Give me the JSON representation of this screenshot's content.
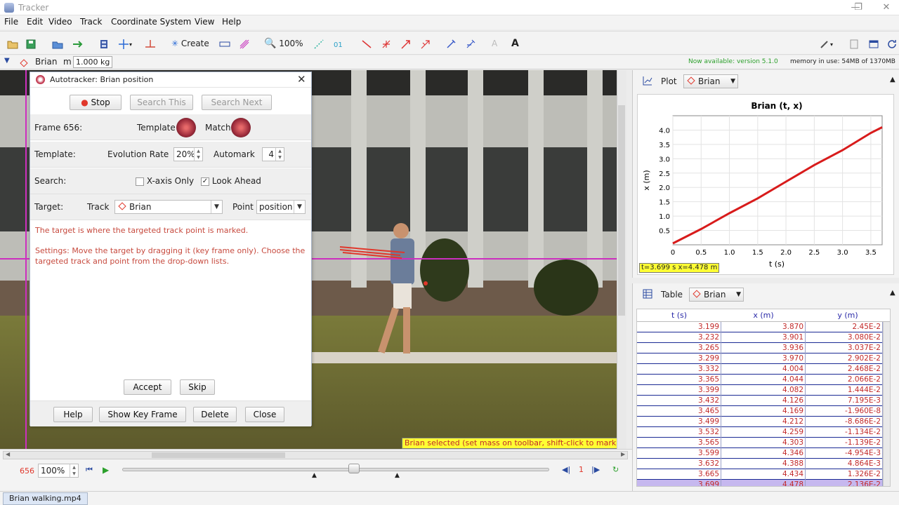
{
  "window": {
    "title": "Tracker"
  },
  "menu": [
    "File",
    "Edit",
    "Video",
    "Track",
    "Coordinate System",
    "View",
    "Help"
  ],
  "toolbar": {
    "create_label": "Create",
    "zoom_label": "100%",
    "font_label": "A"
  },
  "trackbar": {
    "track_name": "Brian",
    "mass_prefix": "m",
    "mass_value": "1.000 kg",
    "version_notice": "Now available: version 5.1.0",
    "memory_label": "memory in use: 54MB of 1370MB"
  },
  "dialog": {
    "title": "Autotracker: Brian position",
    "stop_label": "Stop",
    "search_this_label": "Search This",
    "search_next_label": "Search Next",
    "frame_label": "Frame 656:",
    "template_label": "Template",
    "match_label": "Match",
    "template_row_label": "Template:",
    "evolution_label": "Evolution Rate",
    "evolution_value": "20%",
    "automark_label": "Automark",
    "automark_value": "4",
    "search_row_label": "Search:",
    "xaxis_label": "X-axis Only",
    "lookahead_label": "Look Ahead",
    "target_row_label": "Target:",
    "track_label": "Track",
    "track_value": "Brian",
    "point_label": "Point",
    "point_value": "position",
    "info_line1": "The target is where the targeted track point is marked.",
    "info_line2": "Settings: Move the target by dragging it (key frame only). Choose the",
    "info_line3": "targeted track and point from the drop-down lists.",
    "accept_label": "Accept",
    "skip_label": "Skip",
    "help_label": "Help",
    "showkey_label": "Show Key Frame",
    "delete_label": "Delete",
    "close_label": "Close"
  },
  "video": {
    "status_text": "Brian selected (set mass on toolbar, shift-click to mark)"
  },
  "plot": {
    "tab_label": "Plot",
    "track_value": "Brian",
    "readout": "t=3.699 s  x=4.478 m"
  },
  "chart_data": {
    "type": "line",
    "title": "Brian (t, x)",
    "xlabel": "t (s)",
    "ylabel": "x (m)",
    "xlim": [
      0,
      3.7
    ],
    "ylim": [
      0,
      4.5
    ],
    "xticks": [
      "0",
      "0.5",
      "1.0",
      "1.5",
      "2.0",
      "2.5",
      "3.0",
      "3.5"
    ],
    "yticks": [
      "0.5",
      "1.0",
      "1.5",
      "2.0",
      "2.5",
      "3.0",
      "3.5",
      "4.0"
    ],
    "grid": true,
    "x": [
      0.0,
      0.5,
      1.0,
      1.5,
      2.0,
      2.5,
      3.0,
      3.5,
      3.7
    ],
    "values": [
      0.05,
      0.55,
      1.1,
      1.62,
      2.2,
      2.78,
      3.3,
      3.9,
      4.1
    ]
  },
  "table": {
    "tab_label": "Table",
    "track_value": "Brian",
    "columns": [
      "t (s)",
      "x (m)",
      "y (m)"
    ],
    "rows": [
      [
        "3.199",
        "3.870",
        "2.45E-2"
      ],
      [
        "3.232",
        "3.901",
        "3.080E-2"
      ],
      [
        "3.265",
        "3.936",
        "3.037E-2"
      ],
      [
        "3.299",
        "3.970",
        "2.902E-2"
      ],
      [
        "3.332",
        "4.004",
        "2.468E-2"
      ],
      [
        "3.365",
        "4.044",
        "2.066E-2"
      ],
      [
        "3.399",
        "4.082",
        "1.444E-2"
      ],
      [
        "3.432",
        "4.126",
        "7.195E-3"
      ],
      [
        "3.465",
        "4.169",
        "-1.960E-8"
      ],
      [
        "3.499",
        "4.212",
        "-8.686E-2"
      ],
      [
        "3.532",
        "4.259",
        "-1.134E-2"
      ],
      [
        "3.565",
        "4.303",
        "-1.139E-2"
      ],
      [
        "3.599",
        "4.346",
        "-4.954E-3"
      ],
      [
        "3.632",
        "4.388",
        "4.864E-3"
      ],
      [
        "3.665",
        "4.434",
        "1.326E-2"
      ],
      [
        "3.699",
        "4.478",
        "2.136E-2"
      ]
    ]
  },
  "player": {
    "frame": "656",
    "zoom": "100%",
    "step": "1"
  },
  "status": {
    "file_tab": "Brian walking.mp4"
  },
  "colors": {
    "accent": "#e0372b",
    "track_line": "#d81b1b",
    "axis_line": "#cc2fbf"
  }
}
